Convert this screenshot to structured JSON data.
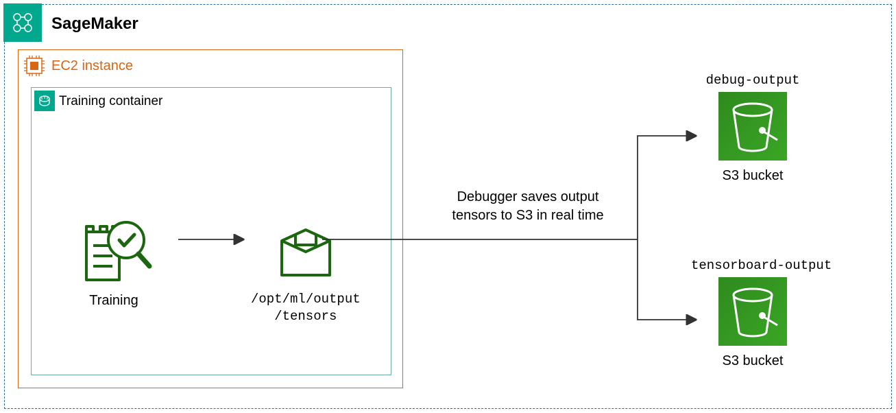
{
  "sagemaker": {
    "title": "SageMaker"
  },
  "ec2": {
    "title": "EC2 instance"
  },
  "container": {
    "title": "Training container"
  },
  "training": {
    "label": "Training"
  },
  "tensors": {
    "line1": "/opt/ml/output",
    "line2": "/tensors"
  },
  "flow": {
    "text": "Debugger saves output tensors to S3 in real time"
  },
  "bucket1": {
    "title": "debug-output",
    "label": "S3 bucket"
  },
  "bucket2": {
    "title": "tensorboard-output",
    "label": "S3 bucket"
  }
}
